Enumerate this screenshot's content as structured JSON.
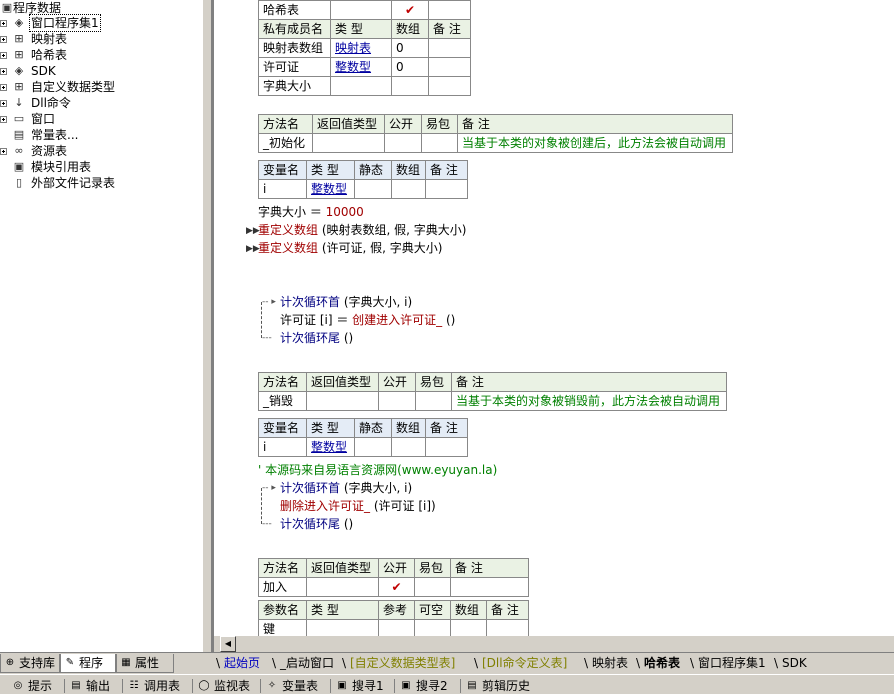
{
  "tree": {
    "items": [
      {
        "label": "程序数据",
        "icon": "folder-open-icon",
        "indent": 0,
        "toggle": "minus"
      },
      {
        "label": "窗口程序集1",
        "icon": "assembly-icon",
        "indent": 1,
        "toggle": "plus",
        "selected": true
      },
      {
        "label": "映射表",
        "icon": "class-icon",
        "indent": 1,
        "toggle": "plus"
      },
      {
        "label": "哈希表",
        "icon": "class-icon",
        "indent": 1,
        "toggle": "plus"
      },
      {
        "label": "SDK",
        "icon": "assembly-icon",
        "indent": 1,
        "toggle": "plus"
      },
      {
        "label": "自定义数据类型",
        "icon": "class-icon",
        "indent": 1,
        "toggle": "plus"
      },
      {
        "label": "Dll命令",
        "icon": "dll-icon",
        "indent": 1,
        "toggle": "plus"
      },
      {
        "label": "窗口",
        "icon": "window-icon",
        "indent": 1,
        "toggle": "plus"
      },
      {
        "label": "常量表...",
        "icon": "constant-icon",
        "indent": 1,
        "toggle": "none"
      },
      {
        "label": "资源表",
        "icon": "resource-icon",
        "indent": 1,
        "toggle": "plus"
      },
      {
        "label": "模块引用表",
        "icon": "module-icon",
        "indent": 1,
        "toggle": "none"
      },
      {
        "label": "外部文件记录表",
        "icon": "file-icon",
        "indent": 1,
        "toggle": "none"
      }
    ]
  },
  "leftTabs": [
    {
      "label": "支持库",
      "icon": "library-icon"
    },
    {
      "label": "程序",
      "icon": "program-icon",
      "active": true
    },
    {
      "label": "属性",
      "icon": "property-icon"
    }
  ],
  "editor": {
    "memberTable": {
      "top_row": [
        "哈希表",
        "",
        "✔",
        "",
        ""
      ],
      "header": [
        "私有成员名",
        "类 型",
        "数组",
        "备 注"
      ],
      "rows": [
        [
          "映射表数组",
          "映射表",
          "0",
          ""
        ],
        [
          "许可证",
          "整数型",
          "0",
          ""
        ],
        [
          "字典大小",
          "",
          "",
          ""
        ]
      ]
    },
    "method1": {
      "header": [
        "方法名",
        "返回值类型",
        "公开",
        "易包",
        "备 注"
      ],
      "row": [
        "_初始化",
        "",
        "",
        "",
        "当基于本类的对象被创建后，此方法会被自动调用"
      ],
      "varHeader": [
        "变量名",
        "类 型",
        "静态",
        "数组",
        "备 注"
      ],
      "varRow": [
        "i",
        "整数型",
        "",
        "",
        ""
      ]
    },
    "code1": {
      "line1": {
        "lhs": "字典大小 ＝ ",
        "rhs": "10000"
      },
      "line2": {
        "fn": "重定义数组",
        "args": " (映射表数组, 假, 字典大小)"
      },
      "line3": {
        "fn": "重定义数组",
        "args": " (许可证, 假, 字典大小)"
      },
      "loopStart": {
        "kw": "计次循环首",
        "args": " (字典大小, i)"
      },
      "loopBody": {
        "lhs": "许可证 [i] ＝ ",
        "fn": "创建进入许可证_",
        "args": " ()"
      },
      "loopEnd": {
        "kw": "计次循环尾",
        "args": " ()"
      }
    },
    "method2": {
      "header": [
        "方法名",
        "返回值类型",
        "公开",
        "易包",
        "备 注"
      ],
      "row": [
        "_销毁",
        "",
        "",
        "",
        "当基于本类的对象被销毁前，此方法会被自动调用"
      ],
      "varHeader": [
        "变量名",
        "类 型",
        "静态",
        "数组",
        "备 注"
      ],
      "varRow": [
        "i",
        "整数型",
        "",
        "",
        ""
      ]
    },
    "code2": {
      "comment": "' 本源码来自易语言资源网(www.eyuyan.la)",
      "loopStart": {
        "kw": "计次循环首",
        "args": " (字典大小, i)"
      },
      "loopBody": {
        "fn": "删除进入许可证_",
        "args": " (许可证 [i])"
      },
      "loopEnd": {
        "kw": "计次循环尾",
        "args": " ()"
      }
    },
    "method3": {
      "header": [
        "方法名",
        "返回值类型",
        "公开",
        "易包",
        "备 注"
      ],
      "row": [
        "加入",
        "",
        "✔",
        "",
        ""
      ],
      "paramHeader": [
        "参数名",
        "类 型",
        "参考",
        "可空",
        "数组",
        "备 注"
      ],
      "paramRow": [
        "键",
        "",
        "",
        "",
        "",
        ""
      ]
    }
  },
  "fileTabs": [
    {
      "label": "起始页",
      "style": "blue2"
    },
    {
      "label": "_启动窗口",
      "style": ""
    },
    {
      "label": "[自定义数据类型表]",
      "style": "olive"
    },
    {
      "label": "[Dll命令定义表]",
      "style": "olive"
    },
    {
      "label": "映射表",
      "style": ""
    },
    {
      "label": "哈希表",
      "style": "active"
    },
    {
      "label": "窗口程序集1",
      "style": ""
    },
    {
      "label": "SDK",
      "style": ""
    }
  ],
  "bottomTabs": [
    {
      "label": "提示",
      "icon": "hint-icon"
    },
    {
      "label": "输出",
      "icon": "output-icon"
    },
    {
      "label": "调用表",
      "icon": "call-table-icon"
    },
    {
      "label": "监视表",
      "icon": "watch-icon"
    },
    {
      "label": "变量表",
      "icon": "variable-icon"
    },
    {
      "label": "搜寻1",
      "icon": "search-icon"
    },
    {
      "label": "搜寻2",
      "icon": "search-icon"
    },
    {
      "label": "剪辑历史",
      "icon": "clipboard-icon"
    }
  ]
}
